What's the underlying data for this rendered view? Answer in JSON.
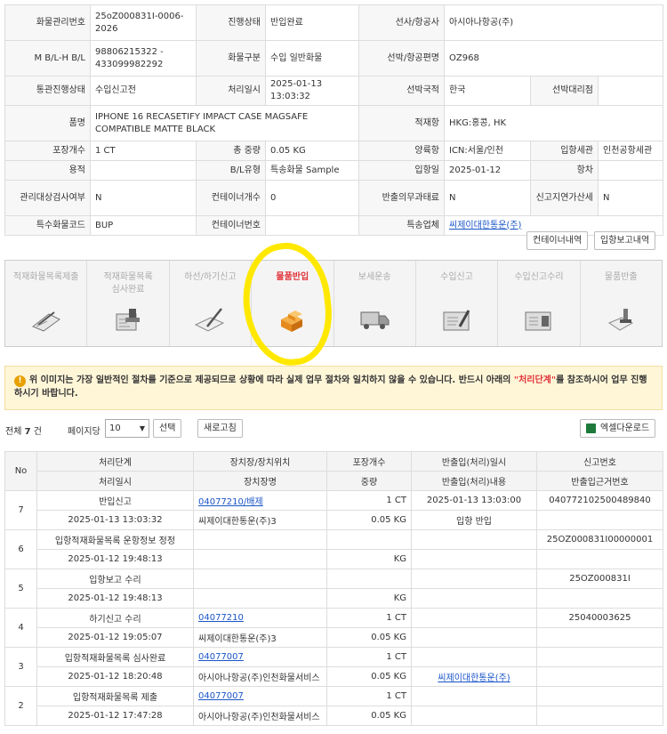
{
  "info": {
    "cargo_no_label": "화물관리번호",
    "cargo_no": "25oZ000831I-0006-2026",
    "progress_label": "진행상태",
    "progress": "반입완료",
    "carrier_label": "선사/항공사",
    "carrier": "아시아나항공(주)",
    "mbl_label": "M B/L-H B/L",
    "mbl": "98806215322 - 433099982292",
    "cargo_type_label": "화물구분",
    "cargo_type": "수입 일반화물",
    "vessel_label": "선박/항공편명",
    "vessel": "OZ968",
    "clearance_label": "통관진행상태",
    "clearance": "수입신고전",
    "proc_time_label": "처리일시",
    "proc_time": "2025-01-13 13:03:32",
    "nation_label": "선박국적",
    "nation": "한국",
    "agent_label": "선박대리점",
    "agent": "",
    "item_label": "품명",
    "item": "IPHONE 16 RECASETIFY IMPACT CASE MAGSAFE COMPATIBLE MATTE BLACK",
    "load_port_label": "적재항",
    "load_port": "HKG:홍콩, HK",
    "pkg_label": "포장개수",
    "pkg": "1 CT",
    "weight_label": "총 중량",
    "weight": "0.05 KG",
    "unload_label": "양륙항",
    "unload": "ICN:서울/인천",
    "customs_label": "입항세관",
    "customs": "인천공항세관",
    "volume_label": "용적",
    "volume": "",
    "bl_type_label": "B/L유형",
    "bl_type": "특송화물 Sample",
    "arrival_label": "입항일",
    "arrival": "2025-01-12",
    "voyage_label": "항차",
    "voyage": "",
    "inspect_label": "관리대상검사여부",
    "inspect": "N",
    "container_cnt_label": "컨테이너개수",
    "container_cnt": "0",
    "release_label": "반출의무과태료",
    "release": "N",
    "late_label": "신고지연가산세",
    "late": "N",
    "special_label": "특수화물코드",
    "special": "BUP",
    "container_no_label": "컨테이너번호",
    "container_no": "",
    "express_label": "특송업체",
    "express": "씨제이대한통운(주)"
  },
  "buttons": {
    "container_list": "컨테이너내역",
    "arrival_report": "입항보고내역"
  },
  "steps": [
    {
      "label": "적재화물목록제출",
      "icon": "clipboard-pencil-icon"
    },
    {
      "label": "적재화물목록\n심사완료",
      "icon": "stamp-icon"
    },
    {
      "label": "하선/하기신고",
      "icon": "pen-paper-icon"
    },
    {
      "label": "물품반입",
      "icon": "boxes-icon"
    },
    {
      "label": "보세운송",
      "icon": "truck-icon"
    },
    {
      "label": "수입신고",
      "icon": "form-pen-icon"
    },
    {
      "label": "수입신고수리",
      "icon": "approved-form-icon"
    },
    {
      "label": "물품반출",
      "icon": "hand-stamp-icon"
    }
  ],
  "notice": {
    "text_before": "위 이미지는 가장 일반적인 절차를 기준으로 제공되므로 상황에 따라 실제 업무 절차와 일치하지 않을 수 있습니다. 반드시 아래의 ",
    "emphasis": "\"처리단계\"",
    "text_after": "를 참조하시어 업무 진행하시기 바랍니다."
  },
  "toolbar": {
    "total_prefix": "전체",
    "total_count": "7",
    "total_suffix": "건",
    "per_page_label": "페이지당",
    "per_page_value": "10",
    "select_button": "선택",
    "refresh_button": "새로고침",
    "excel_button": "엑셀다운로드"
  },
  "grid": {
    "headers_top": [
      "No",
      "처리단계",
      "장치장/장치위치",
      "포장개수",
      "반출입(처리)일시",
      "신고번호"
    ],
    "headers_bottom": [
      "처리일시",
      "장치장명",
      "중량",
      "반출입(처리)내용",
      "반출입근거번호"
    ],
    "rows": [
      {
        "no": "7",
        "step": "반입신고",
        "loc": "04077210/배제",
        "pkg": "1 CT",
        "io_time": "2025-01-13 13:03:00",
        "decl": "040772102500489840",
        "time": "2025-01-13 13:03:32",
        "place": "씨제이대한통운(주)3",
        "weight": "0.05 KG",
        "io_desc": "입항 반입",
        "basis": ""
      },
      {
        "no": "6",
        "step": "입항적재화물목록 운항정보 정정",
        "loc": "",
        "pkg": "",
        "io_time": "",
        "decl": "25OZ000831I00000001",
        "time": "2025-01-12 19:48:13",
        "place": "",
        "weight": "KG",
        "io_desc": "",
        "basis": ""
      },
      {
        "no": "5",
        "step": "입항보고 수리",
        "loc": "",
        "pkg": "",
        "io_time": "",
        "decl": "25OZ000831I",
        "time": "2025-01-12 19:48:13",
        "place": "",
        "weight": "KG",
        "io_desc": "",
        "basis": ""
      },
      {
        "no": "4",
        "step": "하기신고 수리",
        "loc": "04077210",
        "pkg": "1 CT",
        "io_time": "",
        "decl": "25040003625",
        "time": "2025-01-12 19:05:07",
        "place": "씨제이대한통운(주)3",
        "weight": "0.05 KG",
        "io_desc": "",
        "basis": ""
      },
      {
        "no": "3",
        "step": "입항적재화물목록 심사완료",
        "loc": "04077007",
        "pkg": "1 CT",
        "io_time": "",
        "decl": "",
        "time": "2025-01-12 18:20:48",
        "place": "아시아나항공(주)인천화물서비스",
        "weight": "0.05 KG",
        "io_desc": "씨제이대한통운(주)",
        "basis": ""
      },
      {
        "no": "2",
        "step": "입항적재화물목록 제출",
        "loc": "04077007",
        "pkg": "1 CT",
        "io_time": "",
        "decl": "",
        "time": "2025-01-12 17:47:28",
        "place": "아시아나항공(주)인천화물서비스",
        "weight": "0.05 KG",
        "io_desc": "",
        "basis": ""
      }
    ]
  }
}
